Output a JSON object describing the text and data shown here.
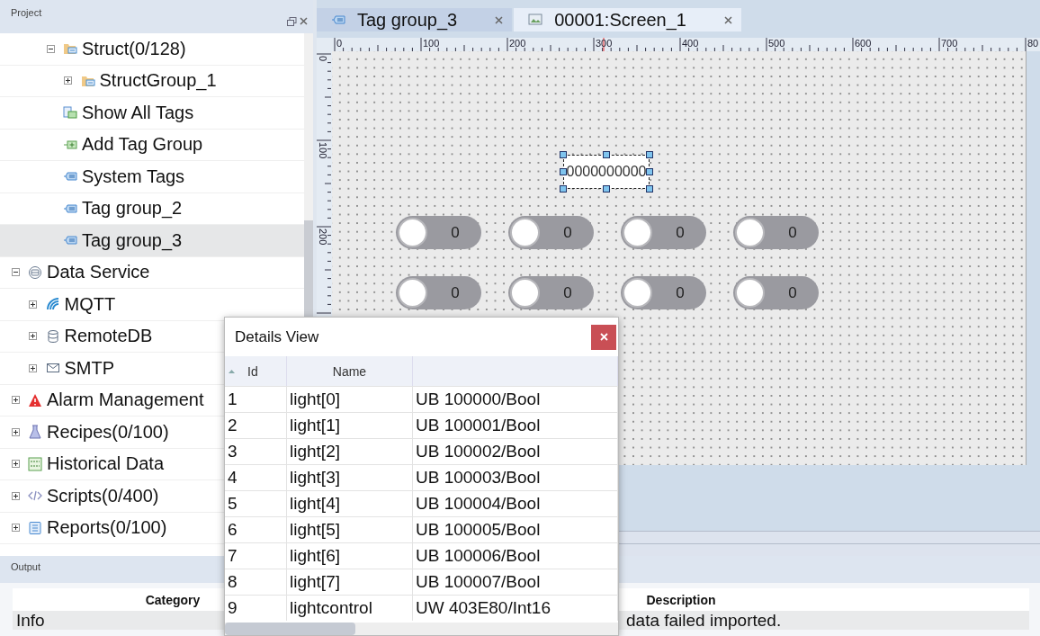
{
  "project_panel": {
    "title": "Project"
  },
  "tree": [
    {
      "children": [
        {
          "children": [
            {
              "label": "Struct(0/128)",
              "kind": "folder",
              "expanded": true,
              "selected": false,
              "children": [
                {
                  "label": "StructGroup_1",
                  "kind": "folder",
                  "expanded": false,
                  "selected": false
                }
              ]
            },
            {
              "label": "Show All Tags",
              "kind": "tags",
              "selected": false
            },
            {
              "label": "Add Tag Group",
              "kind": "add",
              "selected": false
            },
            {
              "label": "System Tags",
              "kind": "tag",
              "selected": false
            },
            {
              "label": "Tag group_2",
              "kind": "tag",
              "selected": false
            },
            {
              "label": "Tag group_3",
              "kind": "tag",
              "selected": true
            }
          ]
        }
      ]
    },
    {
      "label": "Data Service",
      "kind": "service",
      "expanded": true,
      "selected": false,
      "children": [
        {
          "label": "MQTT",
          "kind": "wifi",
          "expanded": false,
          "selected": false
        },
        {
          "label": "RemoteDB",
          "kind": "database",
          "expanded": false,
          "selected": false
        },
        {
          "label": "SMTP",
          "kind": "mail",
          "expanded": false,
          "selected": false
        }
      ]
    },
    {
      "label": "Alarm Management",
      "kind": "alarm",
      "expanded": false,
      "selected": false
    },
    {
      "label": "Recipes(0/100)",
      "kind": "flask",
      "expanded": false,
      "selected": false
    },
    {
      "label": "Historical Data",
      "kind": "binary",
      "expanded": false,
      "selected": false
    },
    {
      "label": "Scripts(0/400)",
      "kind": "code",
      "expanded": false,
      "selected": false
    },
    {
      "label": "Reports(0/100)",
      "kind": "report",
      "expanded": false,
      "selected": false
    }
  ],
  "tabs": [
    {
      "label": "Tag group_3",
      "kind": "tag",
      "selected": false
    },
    {
      "label": "00001:Screen_1",
      "kind": "screen",
      "selected": true
    }
  ],
  "ruler": {
    "x_labels": [
      "0",
      "100",
      "200",
      "300",
      "400",
      "500",
      "600",
      "700",
      "80"
    ],
    "y_labels": [
      "0",
      "100",
      "200"
    ]
  },
  "canvas": {
    "text_field": {
      "value": "0000000000",
      "selected": true
    },
    "toggles": [
      {
        "value": "0",
        "on": false
      },
      {
        "value": "0",
        "on": false
      },
      {
        "value": "0",
        "on": false
      },
      {
        "value": "0",
        "on": false
      },
      {
        "value": "0",
        "on": false
      },
      {
        "value": "0",
        "on": false
      },
      {
        "value": "0",
        "on": false
      },
      {
        "value": "0",
        "on": false
      }
    ]
  },
  "details_view": {
    "title": "Details View",
    "columns": [
      {
        "label": "Id",
        "sorted": true
      },
      {
        "label": "Name",
        "sorted": false
      }
    ],
    "rows": [
      {
        "id": "1",
        "name": "light[0]",
        "address": "UB 100000/Bool"
      },
      {
        "id": "2",
        "name": "light[1]",
        "address": "UB 100001/Bool"
      },
      {
        "id": "3",
        "name": "light[2]",
        "address": "UB 100002/Bool"
      },
      {
        "id": "4",
        "name": "light[3]",
        "address": "UB 100003/Bool"
      },
      {
        "id": "5",
        "name": "light[4]",
        "address": "UB 100004/Bool"
      },
      {
        "id": "6",
        "name": "light[5]",
        "address": "UB 100005/Bool"
      },
      {
        "id": "7",
        "name": "light[6]",
        "address": "UB 100006/Bool"
      },
      {
        "id": "8",
        "name": "light[7]",
        "address": "UB 100007/Bool"
      },
      {
        "id": "9",
        "name": "lightcontrol",
        "address": "UW 403E80/Int16"
      }
    ]
  },
  "output": {
    "title": "Output",
    "columns": [
      "Category",
      "Description"
    ],
    "rows": [
      {
        "category": "Info",
        "description": "data failed imported."
      }
    ]
  }
}
